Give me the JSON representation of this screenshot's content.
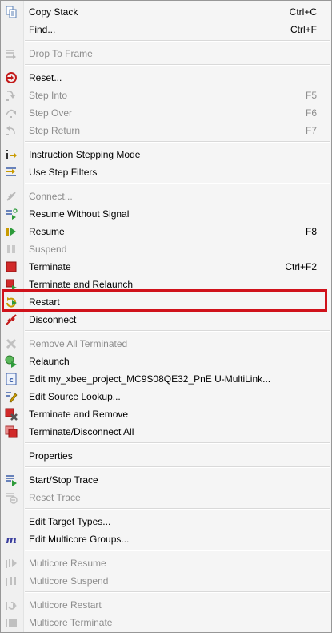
{
  "menu": {
    "copy_stack": {
      "label": "Copy Stack",
      "shortcut": "Ctrl+C"
    },
    "find": {
      "label": "Find...",
      "shortcut": "Ctrl+F"
    },
    "drop_to_frame": {
      "label": "Drop To Frame"
    },
    "reset": {
      "label": "Reset..."
    },
    "step_into": {
      "label": "Step Into",
      "shortcut": "F5"
    },
    "step_over": {
      "label": "Step Over",
      "shortcut": "F6"
    },
    "step_return": {
      "label": "Step Return",
      "shortcut": "F7"
    },
    "instruction_stepping": {
      "label": "Instruction Stepping Mode"
    },
    "use_step_filters": {
      "label": "Use Step Filters"
    },
    "connect": {
      "label": "Connect..."
    },
    "resume_without_signal": {
      "label": "Resume Without Signal"
    },
    "resume": {
      "label": "Resume",
      "shortcut": "F8"
    },
    "suspend": {
      "label": "Suspend"
    },
    "terminate": {
      "label": "Terminate",
      "shortcut": "Ctrl+F2"
    },
    "terminate_relaunch": {
      "label": "Terminate and Relaunch"
    },
    "restart": {
      "label": "Restart"
    },
    "disconnect": {
      "label": "Disconnect"
    },
    "remove_all_terminated": {
      "label": "Remove All Terminated"
    },
    "relaunch": {
      "label": "Relaunch"
    },
    "edit_config": {
      "label": "Edit my_xbee_project_MC9S08QE32_PnE U-MultiLink..."
    },
    "edit_source_lookup": {
      "label": "Edit Source Lookup..."
    },
    "terminate_remove": {
      "label": "Terminate and Remove"
    },
    "terminate_disconnect_all": {
      "label": "Terminate/Disconnect All"
    },
    "properties": {
      "label": "Properties"
    },
    "start_stop_trace": {
      "label": "Start/Stop Trace"
    },
    "reset_trace": {
      "label": "Reset Trace"
    },
    "edit_target_types": {
      "label": "Edit Target Types..."
    },
    "edit_multicore_groups": {
      "label": "Edit Multicore Groups..."
    },
    "multicore_resume": {
      "label": "Multicore Resume"
    },
    "multicore_suspend": {
      "label": "Multicore Suspend"
    },
    "multicore_restart": {
      "label": "Multicore Restart"
    },
    "multicore_terminate": {
      "label": "Multicore Terminate"
    }
  },
  "colors": {
    "highlight_border": "#d0121b",
    "menu_background": "#f5f5f5",
    "disabled_text": "#8d8d8d"
  }
}
